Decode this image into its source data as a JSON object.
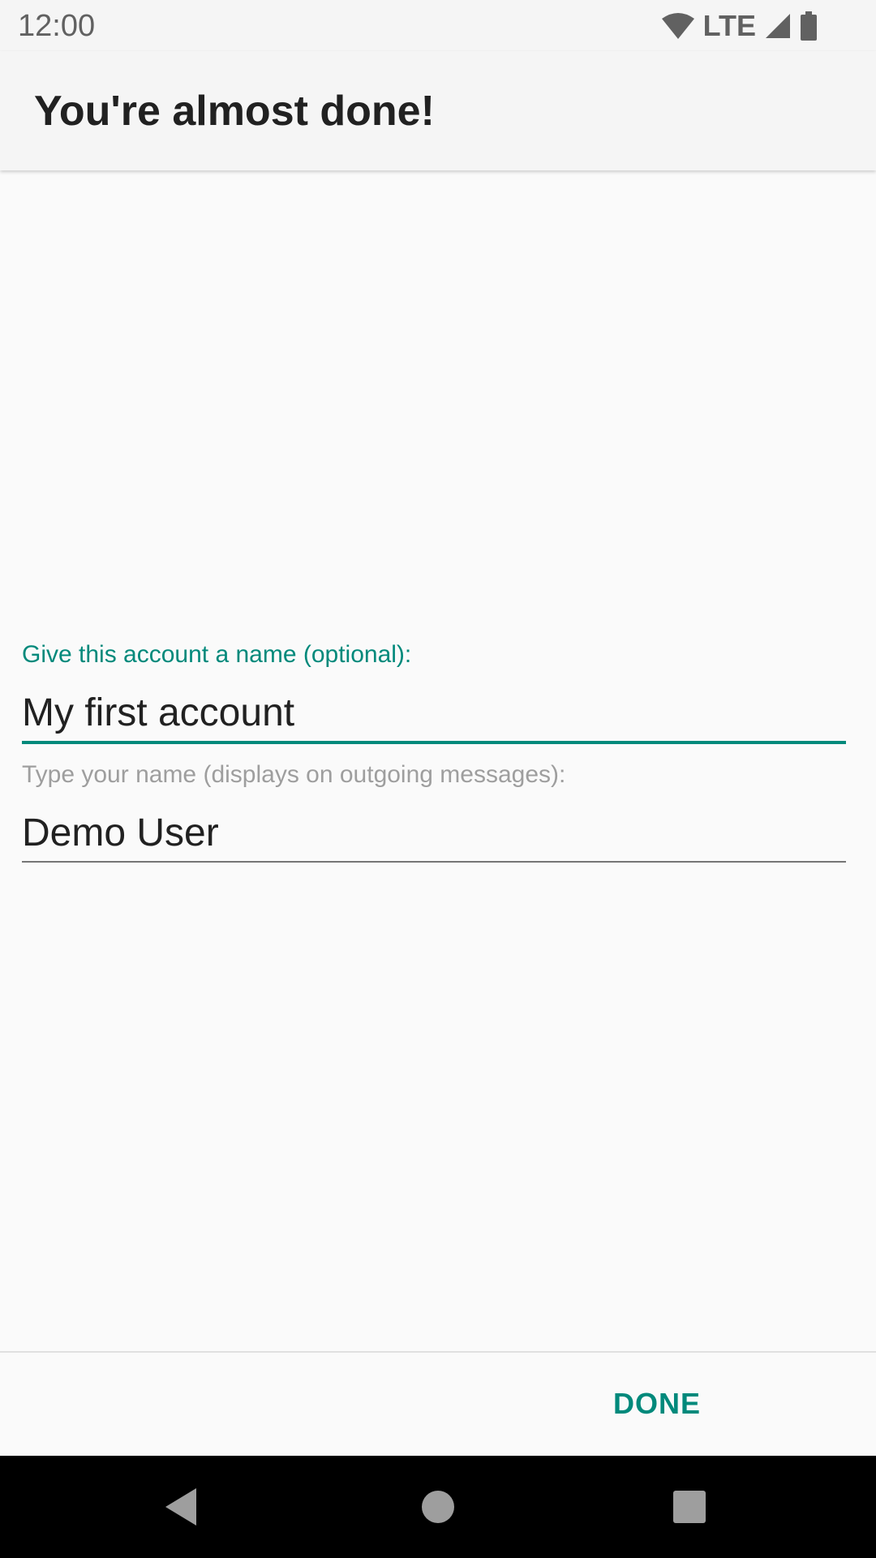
{
  "status_bar": {
    "time": "12:00",
    "network": "LTE",
    "icons": [
      "wifi-icon",
      "cell-signal-icon",
      "battery-icon"
    ]
  },
  "app_bar": {
    "title": "You're almost done!"
  },
  "form": {
    "account_name": {
      "label": "Give this account a name (optional):",
      "value": "My first account"
    },
    "your_name": {
      "label": "Type your name (displays on outgoing messages):",
      "value": "Demo User"
    }
  },
  "actions": {
    "done_label": "DONE"
  },
  "nav_bar": {
    "icons": [
      "back-icon",
      "home-icon",
      "recents-icon"
    ]
  },
  "colors": {
    "accent": "#00897b",
    "background": "#fafafa",
    "app_bar": "#f5f5f5",
    "text_primary": "#212121",
    "text_hint": "#9e9e9e"
  }
}
